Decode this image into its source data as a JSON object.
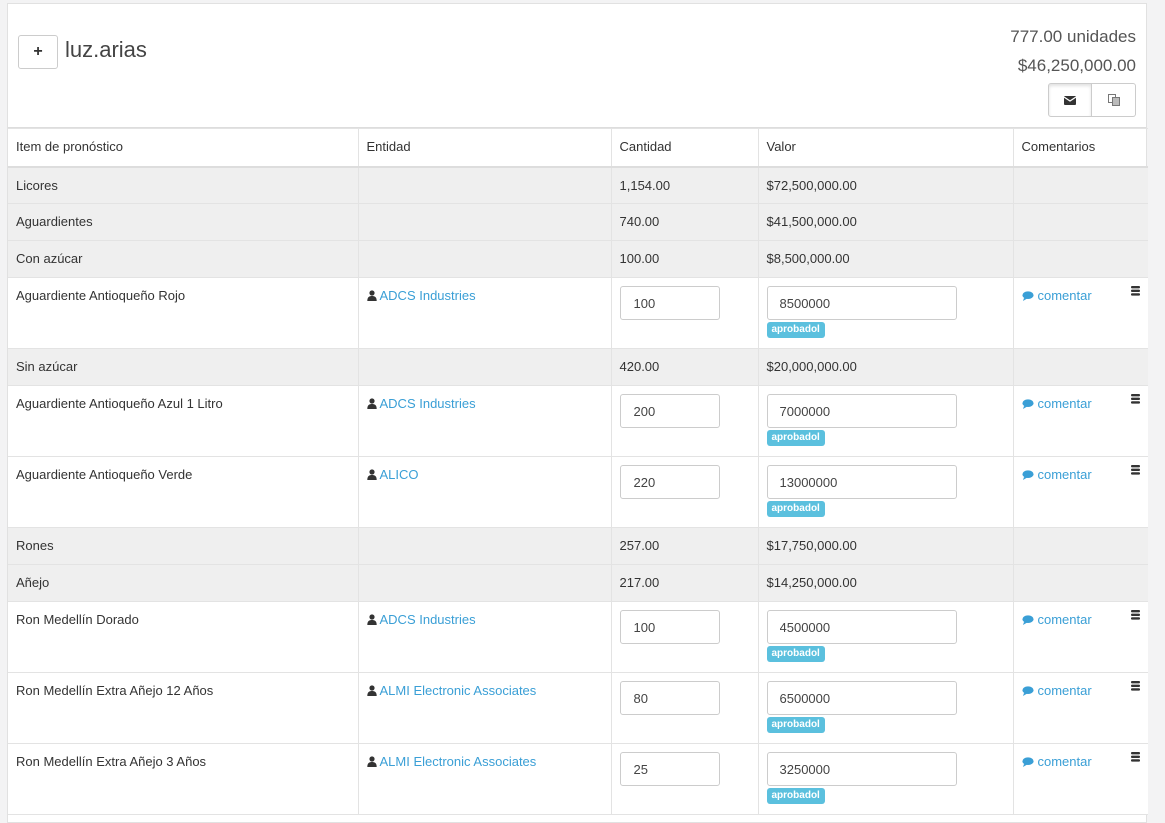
{
  "header": {
    "add_label": "+",
    "title": "luz.arias",
    "units": "777.00 unidades",
    "amount": "$46,250,000.00"
  },
  "columns": [
    "Item de pronóstico",
    "Entidad",
    "Cantidad",
    "Valor",
    "Comentarios"
  ],
  "labels": {
    "badge": "aprobadol",
    "comment": "comentar"
  },
  "rows": [
    {
      "kind": "group",
      "item": "Licores",
      "qty": "1,154.00",
      "value": "$72,500,000.00"
    },
    {
      "kind": "group",
      "item": "Aguardientes",
      "qty": "740.00",
      "value": "$41,500,000.00"
    },
    {
      "kind": "group",
      "item": "Con azúcar",
      "qty": "100.00",
      "value": "$8,500,000.00"
    },
    {
      "kind": "item",
      "item": "Aguardiente Antioqueño Rojo",
      "entity": "ADCS Industries",
      "qty": "100",
      "value": "8500000"
    },
    {
      "kind": "group",
      "item": "Sin azúcar",
      "qty": "420.00",
      "value": "$20,000,000.00"
    },
    {
      "kind": "item",
      "item": "Aguardiente Antioqueño Azul 1 Litro",
      "entity": "ADCS Industries",
      "qty": "200",
      "value": "7000000"
    },
    {
      "kind": "item",
      "item": "Aguardiente Antioqueño Verde",
      "entity": "ALICO",
      "qty": "220",
      "value": "13000000"
    },
    {
      "kind": "group",
      "item": "Rones",
      "qty": "257.00",
      "value": "$17,750,000.00"
    },
    {
      "kind": "group",
      "item": "Añejo",
      "qty": "217.00",
      "value": "$14,250,000.00"
    },
    {
      "kind": "item",
      "item": "Ron Medellín Dorado",
      "entity": "ADCS Industries",
      "qty": "100",
      "value": "4500000"
    },
    {
      "kind": "item",
      "item": "Ron Medellín Extra Añejo 12 Años",
      "entity": "ALMI Electronic Associates",
      "qty": "80",
      "value": "6500000"
    },
    {
      "kind": "item",
      "item": "Ron Medellín Extra Añejo 3 Años",
      "entity": "ALMI Electronic Associates",
      "qty": "25",
      "value": "3250000"
    }
  ]
}
